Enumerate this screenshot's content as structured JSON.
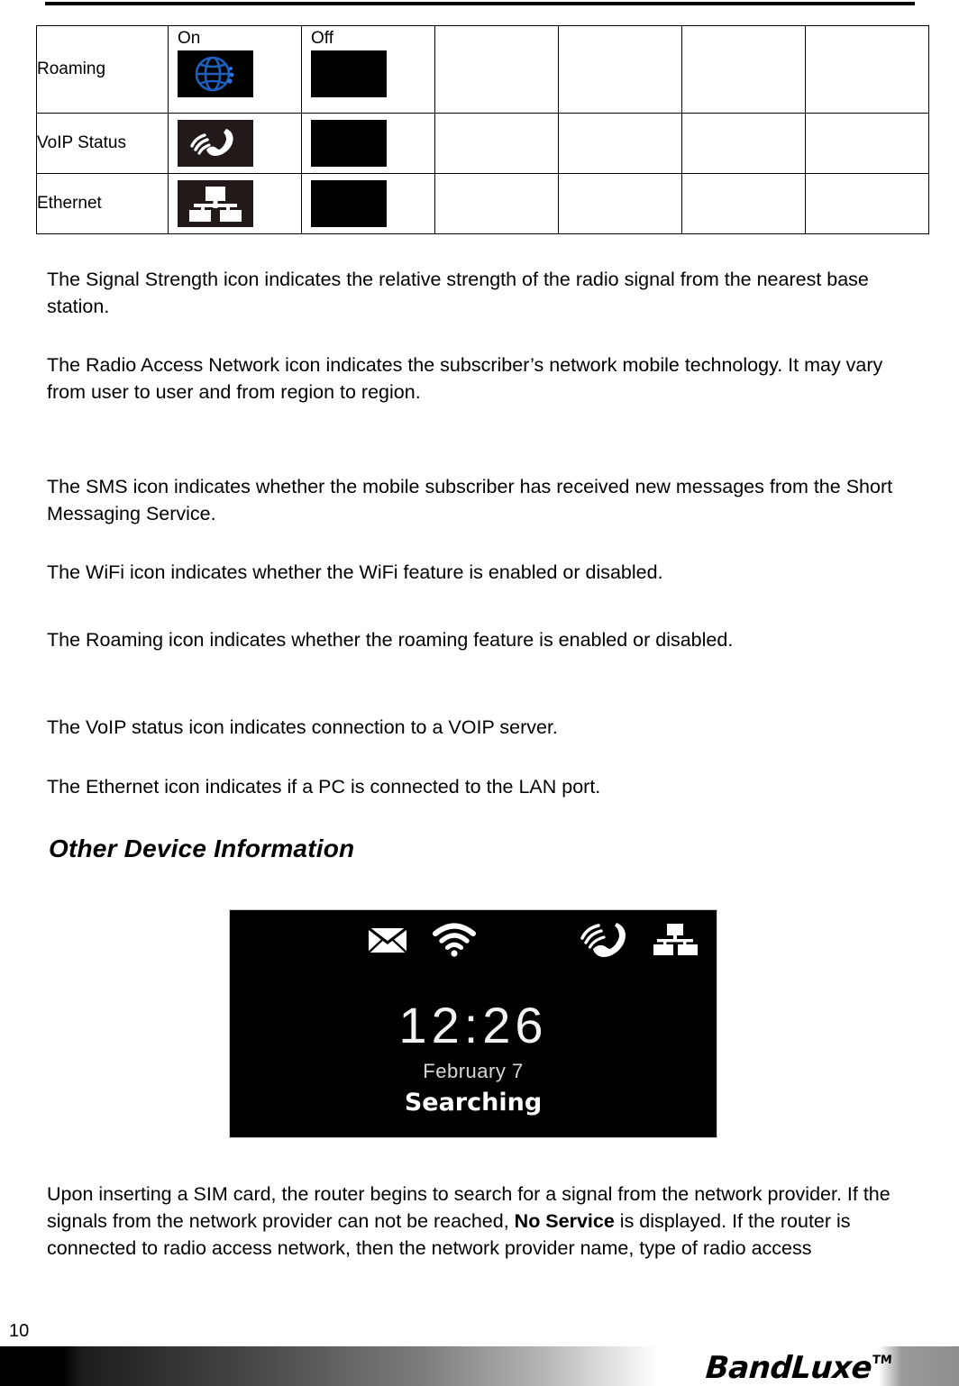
{
  "page": {
    "number": "10",
    "footer_logo": "BandLuxe",
    "footer_logo_tm": "TM"
  },
  "icon_table": {
    "state_headers": {
      "on": "On",
      "off": "Off"
    },
    "rows": [
      {
        "label": "Roaming",
        "on_icon": "roaming-globe-icon",
        "off_icon": "blank-black-icon"
      },
      {
        "label": "VoIP Status",
        "on_icon": "voip-phone-icon",
        "off_icon": "blank-black-icon"
      },
      {
        "label": "Ethernet",
        "on_icon": "ethernet-lan-icon",
        "off_icon": "blank-black-icon"
      }
    ],
    "empty_columns": 4
  },
  "paragraphs": {
    "signal_strength": "The Signal Strength icon indicates the relative strength of the radio signal from the nearest base station.",
    "radio_access_network": "The Radio Access Network icon indicates the subscriber’s network mobile technology. It may vary from user to user and from region to region.",
    "sms": "The SMS icon indicates whether the mobile subscriber has received new messages from the Short Messaging Service.",
    "wifi": "The WiFi icon indicates whether the WiFi feature is enabled or disabled.",
    "roaming": "The Roaming icon indicates whether the roaming feature is enabled or disabled.",
    "voip": "The VoIP status icon indicates connection to a VOIP server.",
    "ethernet": "The Ethernet icon indicates if a PC is connected to the LAN port."
  },
  "heading": {
    "other_device_information": "Other Device Information"
  },
  "device_display": {
    "time": "12:26",
    "date": "February 7",
    "status": "Searching",
    "status_icons": [
      "sms-envelope-icon",
      "wifi-icon",
      "voip-phone-icon",
      "ethernet-lan-icon"
    ]
  },
  "closing_paragraph": {
    "part1": "Upon inserting a SIM card, the router begins to search for a signal from the network provider. If the signals from the network provider can not be reached, ",
    "bold": "No Service",
    "part2": " is displayed. If the router is connected to radio access network, then the network provider name, type of radio access"
  },
  "colors": {
    "roaming_globe": "#1f5fbe",
    "icon_bg": "#000000",
    "voip_bg": "#221a18"
  }
}
